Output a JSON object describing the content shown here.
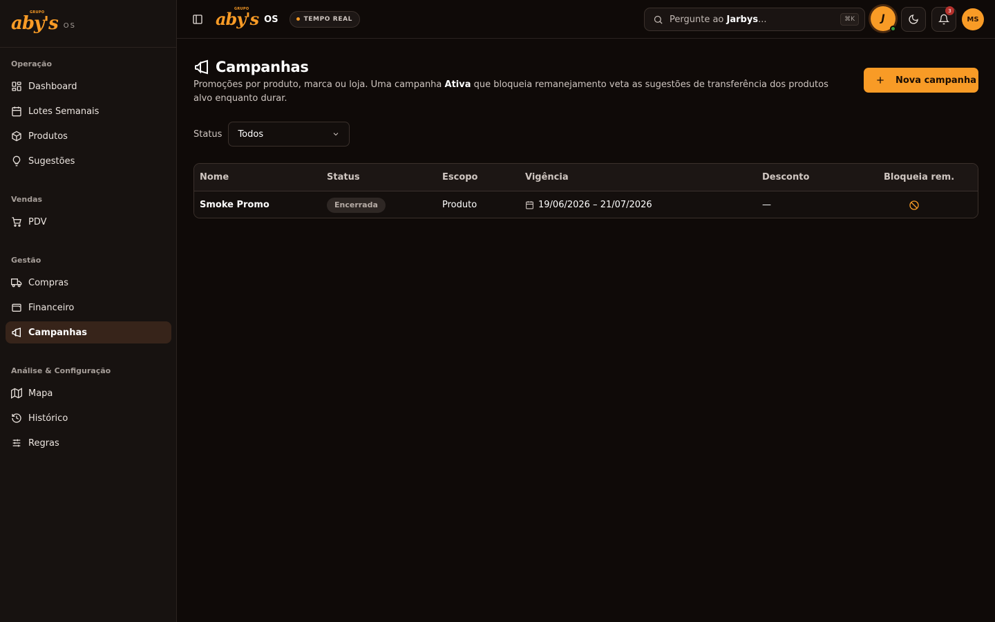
{
  "brand": {
    "logo_text": "aby's",
    "logo_grupo": "GRUPO",
    "suffix": "OS"
  },
  "sidebar": {
    "sections": [
      {
        "title": "Operação",
        "items": [
          {
            "label": "Dashboard",
            "icon": "dashboard-icon"
          },
          {
            "label": "Lotes Semanais",
            "icon": "calendar-icon"
          },
          {
            "label": "Produtos",
            "icon": "package-icon"
          },
          {
            "label": "Sugestões",
            "icon": "lightbulb-icon"
          }
        ]
      },
      {
        "title": "Vendas",
        "items": [
          {
            "label": "PDV",
            "icon": "cart-icon"
          }
        ]
      },
      {
        "title": "Gestão",
        "items": [
          {
            "label": "Compras",
            "icon": "truck-icon"
          },
          {
            "label": "Financeiro",
            "icon": "wallet-icon"
          },
          {
            "label": "Campanhas",
            "icon": "megaphone-icon",
            "active": true
          }
        ]
      },
      {
        "title": "Análise & Configuração",
        "items": [
          {
            "label": "Mapa",
            "icon": "map-icon"
          },
          {
            "label": "Histórico",
            "icon": "history-icon"
          },
          {
            "label": "Regras",
            "icon": "sliders-icon"
          }
        ]
      }
    ]
  },
  "topbar": {
    "os_label": "OS",
    "realtime_label": "TEMPO REAL",
    "search_prefix": "Pergunte ao ",
    "search_name": "Jarbys",
    "search_suffix": "...",
    "search_shortcut": "⌘K",
    "assistant_initial": "J",
    "notifications_count": "3",
    "user_initials": "MS"
  },
  "page": {
    "title": "Campanhas",
    "desc_part1": "Promoções por produto, marca ou loja. Uma campanha ",
    "desc_bold": "Ativa",
    "desc_part2": " que bloqueia remanejamento veta as sugestões de transferência dos produtos alvo enquanto durar.",
    "new_button": "Nova campanha",
    "filter_label": "Status",
    "filter_value": "Todos"
  },
  "table": {
    "headers": [
      "Nome",
      "Status",
      "Escopo",
      "Vigência",
      "Desconto",
      "Bloqueia rem."
    ],
    "rows": [
      {
        "name": "Smoke Promo",
        "status": "Encerrada",
        "scope": "Produto",
        "period": "19/06/2026 – 21/07/2026",
        "discount": "—",
        "blocks": "no-entry-icon"
      }
    ]
  },
  "colors": {
    "accent": "#f89b26",
    "background": "#0f0a08",
    "sidebar": "#171210"
  }
}
